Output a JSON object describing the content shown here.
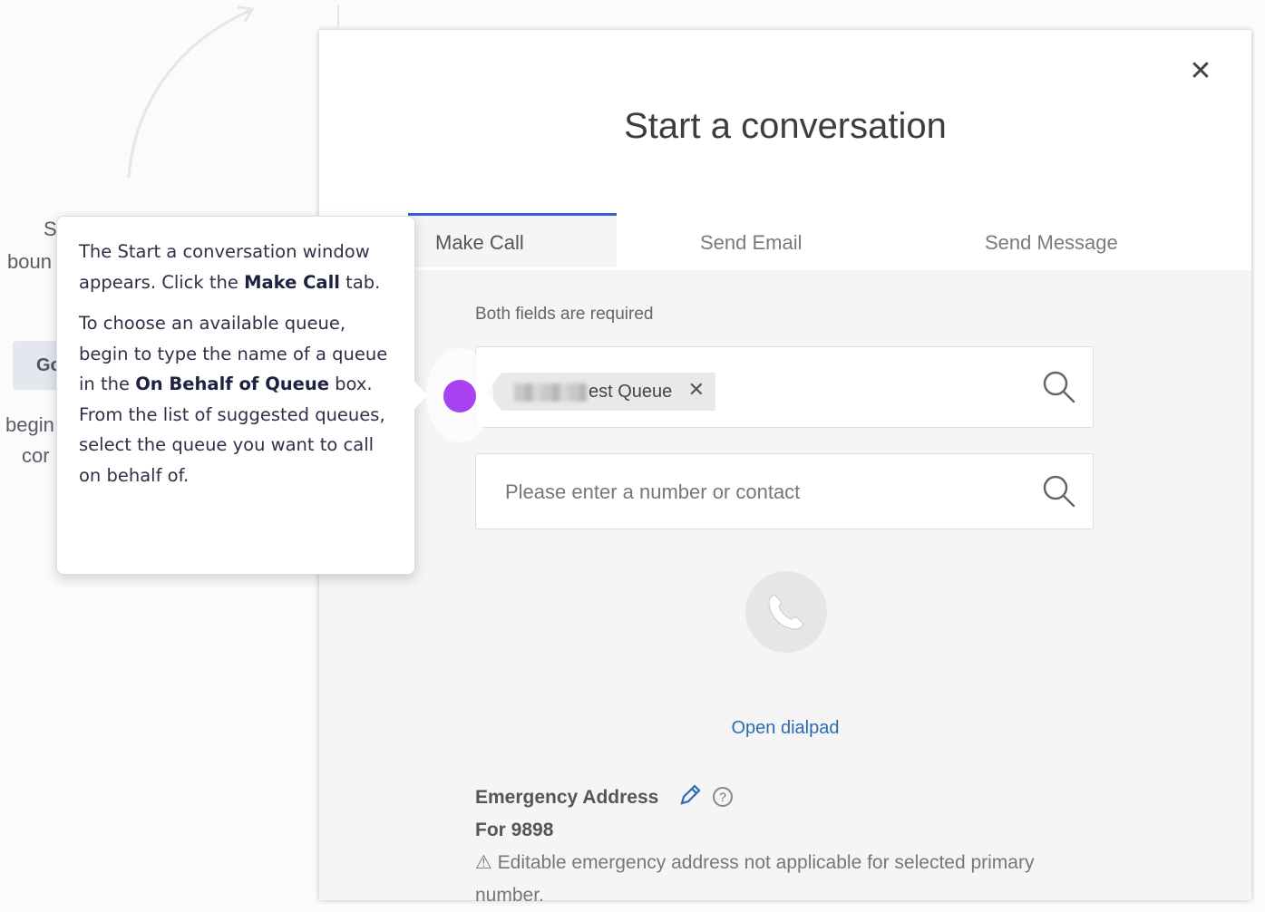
{
  "background": {
    "fragments": [
      "S",
      "boun",
      "Go",
      "begin",
      "cor"
    ]
  },
  "modal": {
    "title": "Start a conversation",
    "close_glyph": "✕",
    "tabs": [
      {
        "label": "Make Call",
        "active": true
      },
      {
        "label": "Send Email",
        "active": false
      },
      {
        "label": "Send Message",
        "active": false
      }
    ],
    "required_note": "Both fields are required",
    "queue_chip": {
      "label": "est Queue",
      "remove_glyph": "✕"
    },
    "number_field": {
      "placeholder": "Please enter a number or contact",
      "value": ""
    },
    "call_icon": "phone-icon",
    "dialpad_link": "Open dialpad",
    "emergency": {
      "title": "Emergency Address",
      "for_label": "For 9898",
      "note": "⚠ Editable emergency address not applicable for selected primary number.",
      "edit_icon": "pencil-icon",
      "help_glyph": "?"
    }
  },
  "tooltip": {
    "p1_a": "The Start a conversation window appears. Click the ",
    "p1_b": "Make Call",
    "p1_c": " tab.",
    "p2_a": "To choose an available queue, begin to type the name of a queue in the ",
    "p2_b": "On Behalf of Queue",
    "p2_c": " box. From the list of suggested queues, select the queue you want to call on behalf of."
  },
  "colors": {
    "accent_tab": "#3b5bdb",
    "beacon": "#a741f2",
    "link": "#2b6cb0"
  }
}
